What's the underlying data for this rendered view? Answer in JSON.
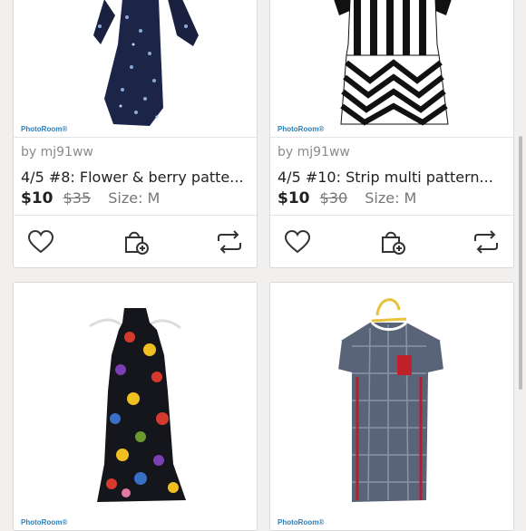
{
  "listings": [
    {
      "watermark": "PhotoRoom®",
      "seller": "by mj91ww",
      "title": "4/5 #8: Flower & berry patte...",
      "price": "$10",
      "original_price": "$35",
      "size": "Size: M",
      "icons": [
        "heart-icon",
        "add-to-bundle-icon",
        "share-icon"
      ]
    },
    {
      "watermark": "PhotoRoom®",
      "seller": "by mj91ww",
      "title": "4/5 #10: Strip multi pattern...",
      "price": "$10",
      "original_price": "$30",
      "size": "Size: M",
      "icons": [
        "heart-icon",
        "add-to-bundle-icon",
        "share-icon"
      ]
    },
    {
      "watermark": "PhotoRoom®"
    },
    {
      "watermark": "PhotoRoom®"
    }
  ],
  "colors": {
    "background": "#f2f0ee",
    "watermark": "#2a7fb8",
    "price": "#222222",
    "muted": "#8a8a8a"
  }
}
